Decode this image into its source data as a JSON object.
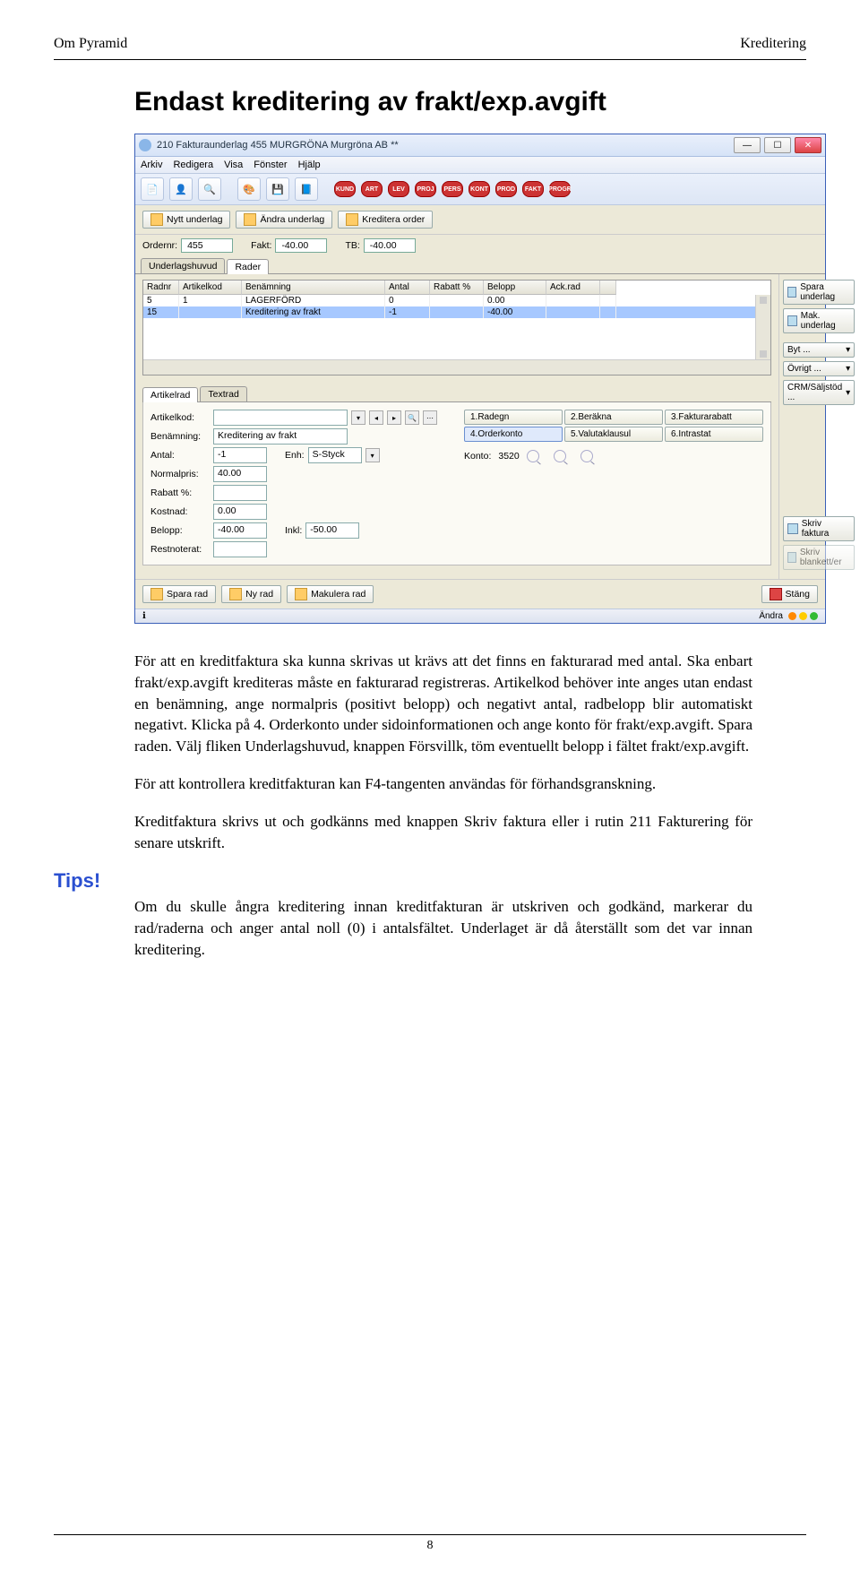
{
  "header": {
    "left": "Om Pyramid",
    "right": "Kreditering"
  },
  "section_title": "Endast kreditering av frakt/exp.avgift",
  "window": {
    "title": "210 Fakturaunderlag 455 MURGRÖNA Murgröna AB **",
    "menu": [
      "Arkiv",
      "Redigera",
      "Visa",
      "Fönster",
      "Hjälp"
    ],
    "quick_tags": [
      "KUND",
      "ART",
      "LEV",
      "PROJ",
      "PERS",
      "KONT",
      "PROD",
      "FAKT",
      "PROGR"
    ],
    "actions": {
      "new_doc": "Nytt underlag",
      "edit_doc": "Ändra underlag",
      "credit_order": "Kreditera order"
    },
    "order": {
      "ordernr_label": "Ordernr:",
      "ordernr": "455",
      "fakt_label": "Fakt:",
      "fakt": "-40.00",
      "tb_label": "TB:",
      "tb": "-40.00"
    },
    "tabs_top": {
      "huvud": "Underlagshuvud",
      "rader": "Rader"
    },
    "grid": {
      "headers": [
        "Radnr",
        "Artikelkod",
        "Benämning",
        "Antal",
        "Rabatt %",
        "Belopp",
        "Ack.rad"
      ],
      "rows": [
        {
          "radnr": "5",
          "artikelkod": "1",
          "benamning": "LAGERFÖRD",
          "antal": "0",
          "rabatt": "",
          "belopp": "0.00",
          "ack": ""
        },
        {
          "radnr": "15",
          "artikelkod": "",
          "benamning": "Kreditering av frakt",
          "antal": "-1",
          "rabatt": "",
          "belopp": "-40.00",
          "ack": ""
        }
      ]
    },
    "side": {
      "save_doc": "Spara underlag",
      "del_doc": "Mak. underlag",
      "byt": "Byt ...",
      "ovrigt": "Övrigt ...",
      "crm": "CRM/Säljstöd ...",
      "skriv_faktura": "Skriv faktura",
      "skriv_blankett": "Skriv blankett/er"
    },
    "tabs_detail": {
      "artikelrad": "Artikelrad",
      "textrad": "Textrad"
    },
    "form": {
      "artikelkod_label": "Artikelkod:",
      "benamning_label": "Benämning:",
      "benamning": "Kreditering av frakt",
      "antal_label": "Antal:",
      "antal": "-1",
      "enh_label": "Enh:",
      "enh": "S-Styck",
      "normalpris_label": "Normalpris:",
      "normalpris": "40.00",
      "rabatt_label": "Rabatt %:",
      "kostnad_label": "Kostnad:",
      "kostnad": "0.00",
      "belopp_label": "Belopp:",
      "belopp": "-40.00",
      "inkl_label": "Inkl:",
      "inkl": "-50.00",
      "restnoterat_label": "Restnoterat:"
    },
    "link_buttons": [
      "1.Radegn",
      "2.Beräkna",
      "3.Fakturarabatt",
      "4.Orderkonto",
      "5.Valutaklausul",
      "6.Intrastat"
    ],
    "konto": {
      "label": "Konto:",
      "value": "3520"
    },
    "bottom": {
      "save_row": "Spara rad",
      "new_row": "Ny rad",
      "del_row": "Makulera rad",
      "close": "Stäng"
    },
    "statusbar": {
      "text": "Ändra"
    }
  },
  "body": {
    "p1": "För att en kreditfaktura ska kunna skrivas ut krävs att det finns en fakturarad med antal. Ska enbart frakt/exp.avgift krediteras måste en fakturarad registreras. Artikelkod behöver inte anges utan endast en benämning, ange normalpris (positivt belopp) och negativt antal, radbelopp blir automatiskt negativt. Klicka på 4. Orderkonto under sidoinformationen och ange konto för frakt/exp.avgift. Spara raden. Välj fliken Underlagshuvud, knappen Försvillk, töm eventuellt belopp i fältet frakt/exp.avgift.",
    "p2": "För att kontrollera kreditfakturan kan F4-tangenten användas för förhandsgranskning.",
    "p3": "Kreditfaktura skrivs ut och godkänns med knappen Skriv faktura eller i rutin 211 Fakturering för senare utskrift."
  },
  "tips": {
    "label": "Tips!",
    "text": "Om du skulle ångra kreditering innan kreditfakturan är utskriven och godkänd, markerar du rad/raderna och anger antal noll (0) i antalsfältet. Underlaget är då återställt som det var innan kreditering."
  },
  "page_number": "8"
}
